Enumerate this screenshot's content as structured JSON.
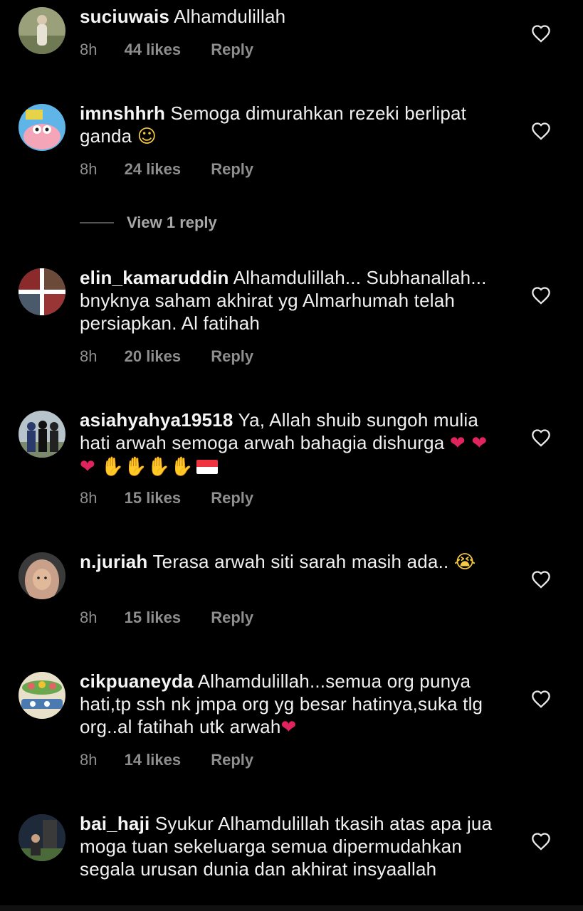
{
  "comments": [
    {
      "username": "suciuwais",
      "text": "Alhamdulillah",
      "time": "8h",
      "likes": "44 likes",
      "reply": "Reply"
    },
    {
      "username": "imnshhrh",
      "text": "Semoga dimurahkan rezeki berlipat ganda",
      "emoji": "☺",
      "time": "8h",
      "likes": "24 likes",
      "reply": "Reply",
      "view_replies": "View 1 reply"
    },
    {
      "username": "elin_kamaruddin",
      "text": "Alhamdulillah... Subhanallah... bnyknya saham akhirat yg Almarhumah telah persiapkan. Al fatihah",
      "time": "8h",
      "likes": "20 likes",
      "reply": "Reply"
    },
    {
      "username": "asiahyahya19518",
      "text": "Ya, Allah shuib sungoh mulia hati arwah semoga arwah bahagia dishurga",
      "emoji_hearts": "❤ ❤ ❤",
      "emoji_hands": "✋✋✋✋",
      "time": "8h",
      "likes": "15 likes",
      "reply": "Reply"
    },
    {
      "username": "n.juriah",
      "text": "Terasa arwah siti sarah masih ada..",
      "emoji": "😭",
      "time": "8h",
      "likes": "15 likes",
      "reply": "Reply"
    },
    {
      "username": "cikpuaneyda",
      "text": "Alhamdulillah...semua org punya hati,tp ssh nk jmpa org yg besar hatinya,suka tlg org..al fatihah utk arwah",
      "emoji": "❤",
      "time": "8h",
      "likes": "14 likes",
      "reply": "Reply"
    },
    {
      "username": "bai_haji",
      "text": "Syukur Alhamdulillah tkasih atas apa jua moga tuan sekeluarga semua dipermudahkan segala urusan dunia dan akhirat insyaallah"
    }
  ],
  "icons": {
    "like": "heart-outline-icon"
  },
  "colors": {
    "background": "#000000",
    "meta_text": "#8e8e8e",
    "heart_emoji": "#e0245e"
  }
}
